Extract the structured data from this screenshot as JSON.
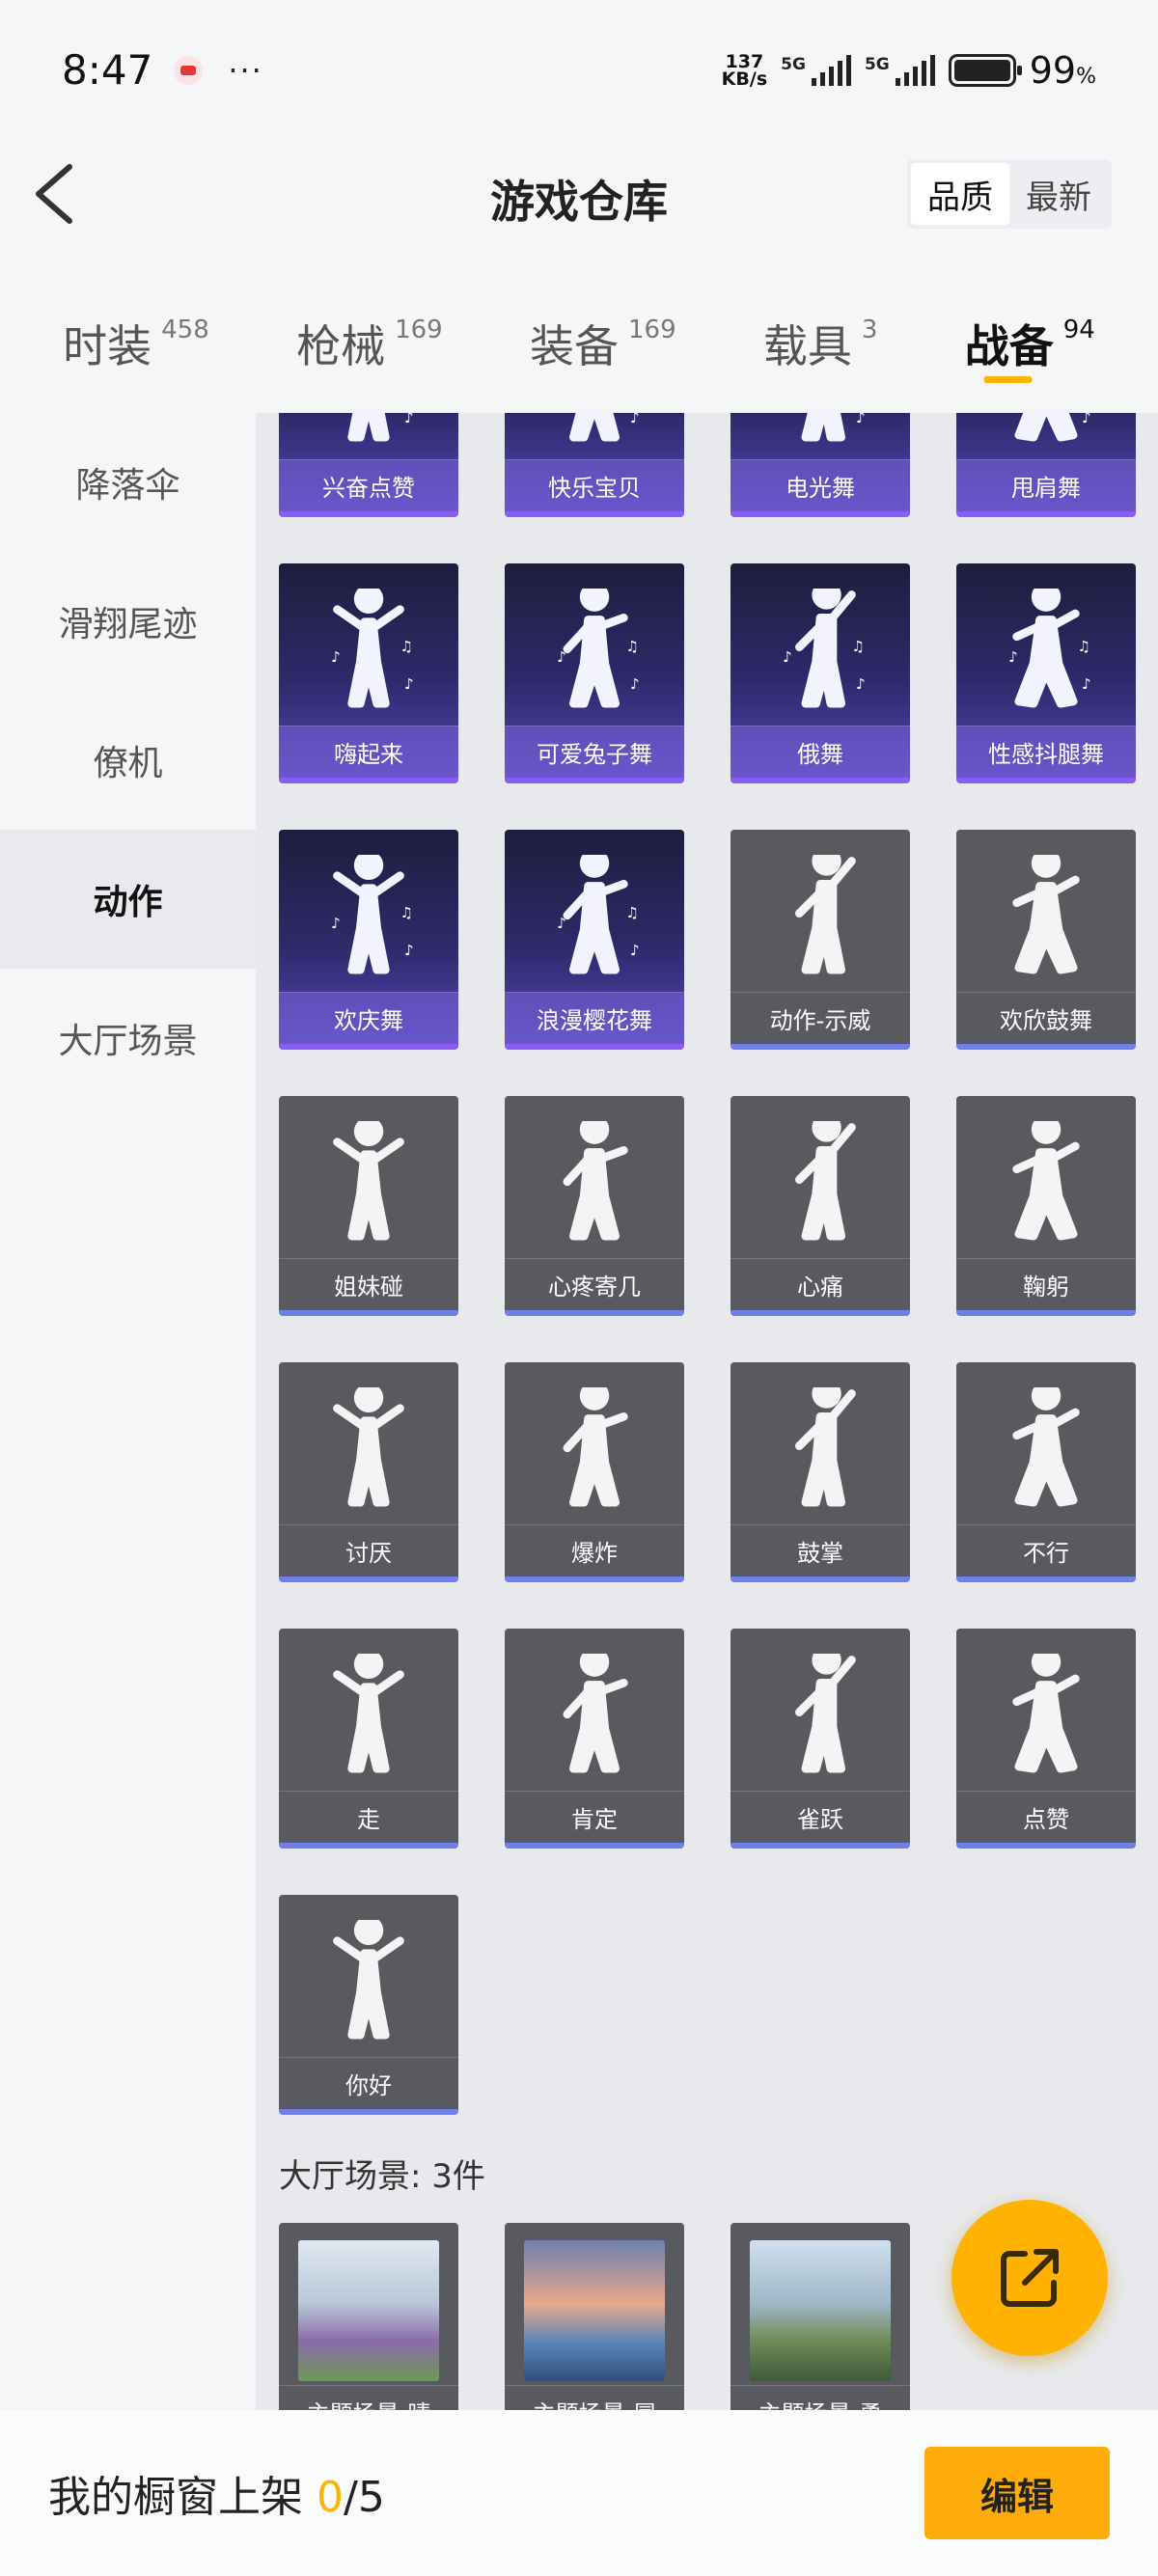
{
  "status_bar": {
    "time": "8:47",
    "dots": "···",
    "net_speed_value": "137",
    "net_speed_unit": "KB/s",
    "signal_1": "5G",
    "signal_2": "5G",
    "battery_value": "99",
    "battery_unit": "%"
  },
  "header": {
    "title": "游戏仓库",
    "sort_options": [
      "品质",
      "最新"
    ],
    "sort_selected": "品质"
  },
  "tabs": [
    {
      "label": "时装",
      "count": "458"
    },
    {
      "label": "枪械",
      "count": "169"
    },
    {
      "label": "装备",
      "count": "169"
    },
    {
      "label": "载具",
      "count": "3"
    },
    {
      "label": "战备",
      "count": "94",
      "active": true
    }
  ],
  "sidebar": {
    "items": [
      "降落伞",
      "滑翔尾迹",
      "僚机",
      "动作",
      "大厅场景"
    ],
    "active": "动作"
  },
  "actions": [
    {
      "name": "兴奋点赞",
      "style": "purple"
    },
    {
      "name": "快乐宝贝",
      "style": "purple"
    },
    {
      "name": "电光舞",
      "style": "purple"
    },
    {
      "name": "甩肩舞",
      "style": "purple"
    },
    {
      "name": "嗨起来",
      "style": "purple"
    },
    {
      "name": "可爱兔子舞",
      "style": "purple"
    },
    {
      "name": "俄舞",
      "style": "purple"
    },
    {
      "name": "性感抖腿舞",
      "style": "purple"
    },
    {
      "name": "欢庆舞",
      "style": "purple"
    },
    {
      "name": "浪漫樱花舞",
      "style": "purple"
    },
    {
      "name": "动作-示威",
      "style": "gray"
    },
    {
      "name": "欢欣鼓舞",
      "style": "gray"
    },
    {
      "name": "姐妹碰",
      "style": "gray"
    },
    {
      "name": "心疼寄几",
      "style": "gray"
    },
    {
      "name": "心痛",
      "style": "gray"
    },
    {
      "name": "鞠躬",
      "style": "gray"
    },
    {
      "name": "讨厌",
      "style": "gray"
    },
    {
      "name": "爆炸",
      "style": "gray"
    },
    {
      "name": "鼓掌",
      "style": "gray"
    },
    {
      "name": "不行",
      "style": "gray"
    },
    {
      "name": "走",
      "style": "gray"
    },
    {
      "name": "肯定",
      "style": "gray"
    },
    {
      "name": "雀跃",
      "style": "gray"
    },
    {
      "name": "点赞",
      "style": "gray"
    },
    {
      "name": "你好",
      "style": "gray"
    }
  ],
  "lobby_scenes": {
    "section_title": "大厅场景: 3件",
    "items": [
      {
        "name": "主题场景-晴",
        "colors": [
          "#dfe9f2",
          "#b9c7d8",
          "#8a6aa8",
          "#6f9a55"
        ]
      },
      {
        "name": "主题场景-冒",
        "colors": [
          "#6f7fb0",
          "#e7a98b",
          "#5f86b8",
          "#2c4f7d"
        ]
      },
      {
        "name": "主题场景-勇",
        "colors": [
          "#cfe0ee",
          "#9fb7c8",
          "#6e8a55",
          "#3e5a3a"
        ]
      }
    ]
  },
  "bottom_bar": {
    "label": "我的橱窗上架",
    "current": "0",
    "total": "/5",
    "edit_label": "编辑"
  },
  "colors": {
    "accent": "#ffb300",
    "purple_card": "#2d2a6b",
    "gray_card": "#595a60",
    "card_stripe": "#6f7ee8"
  }
}
